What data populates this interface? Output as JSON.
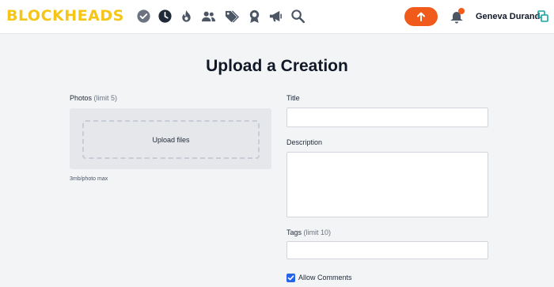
{
  "app": {
    "logo": "BLOCKHEADS",
    "brand_color": "#f5c518",
    "accent_color": "#f05a1a"
  },
  "nav": {
    "icons": [
      "check-circle-icon",
      "clock-icon",
      "flame-icon",
      "users-icon",
      "tags-icon",
      "award-icon",
      "megaphone-icon",
      "search-icon"
    ],
    "upload_icon": "arrow-up-icon",
    "notification_icon": "bell-icon",
    "user_name": "Geneva Durand",
    "profile_icon": "profile-icon"
  },
  "page": {
    "title": "Upload a Creation"
  },
  "photos": {
    "label": "Photos",
    "limit": "(limit 5)",
    "dropzone_text": "Upload files",
    "hint": "3mb/photo max"
  },
  "form": {
    "title_label": "Title",
    "title_value": "",
    "description_label": "Description",
    "description_value": "",
    "tags_label": "Tags",
    "tags_limit": "(limit 10)",
    "tags_value": "",
    "allow_comments_label": "Allow Comments",
    "allow_comments_checked": true
  }
}
